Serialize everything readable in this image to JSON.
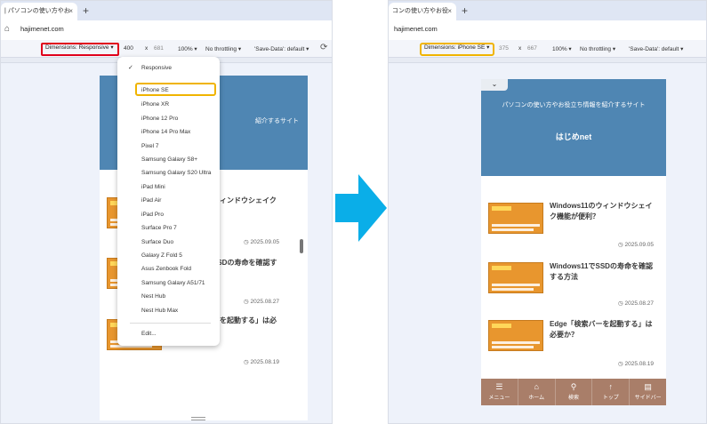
{
  "left": {
    "tab_title": "| パソコンの使い方やお",
    "tab_close": "×",
    "new_tab": "+",
    "address": "hajimenet.com",
    "toolbar": {
      "dimensions_label": "Dimensions: Responsive ▾",
      "width": "400",
      "times": "x",
      "height": "681",
      "zoom": "100% ▾",
      "throttling": "No throttling ▾",
      "save_data": "'Save-Data': default ▾"
    },
    "dropdown": {
      "checkmark": "✓",
      "items": [
        "Responsive",
        "iPhone SE",
        "iPhone XR",
        "iPhone 12 Pro",
        "iPhone 14 Pro Max",
        "Pixel 7",
        "Samsung Galaxy S8+",
        "Samsung Galaxy S20 Ultra",
        "iPad Mini",
        "iPad Air",
        "iPad Pro",
        "Surface Pro 7",
        "Surface Duo",
        "Galaxy Z Fold 5",
        "Asus Zenbook Fold",
        "Samsung Galaxy A51/71",
        "Nest Hub",
        "Nest Hub Max"
      ],
      "edit": "Edit..."
    },
    "page": {
      "hero_tagline": "紹介するサイト",
      "articles": [
        {
          "title_line1": "ウィンドウシェイク",
          "title_line2": "",
          "date": "◷ 2025.09.05"
        },
        {
          "title_line1": "SSDの寿命を確認す",
          "title_line2": "",
          "date": "◷ 2025.08.27"
        },
        {
          "title_line1": "ーを起動する」は必",
          "title_line2": "",
          "date": "◷ 2025.08.19"
        }
      ]
    }
  },
  "right": {
    "tab_title": "コンの使い方やお役",
    "tab_close": "×",
    "new_tab": "+",
    "address": "hajimenet.com",
    "toolbar": {
      "dimensions_label": "Dimensions: iPhone SE ▾",
      "width": "375",
      "times": "x",
      "height": "667",
      "zoom": "100% ▾",
      "throttling": "No throttling ▾",
      "save_data": "'Save-Data': default ▾"
    },
    "page": {
      "chevron": "⌄",
      "hero_tagline": "パソコンの使い方やお役立ち情報を紹介するサイト",
      "brand": "はじめnet",
      "articles": [
        {
          "title_line1": "Windows11のウィンドウシェイ",
          "title_line2": "ク機能が便利？",
          "date": "◷ 2025.09.05"
        },
        {
          "title_line1": "Windows11でSSDの寿命を確認",
          "title_line2": "する方法",
          "date": "◷ 2025.08.27"
        },
        {
          "title_line1": "Edge「検索バーを起動する」は",
          "title_line2": "必要か？",
          "date": "◷ 2025.08.19"
        }
      ],
      "nav": [
        {
          "icon": "☰",
          "label": "メニュー"
        },
        {
          "icon": "⌂",
          "label": "ホーム"
        },
        {
          "icon": "⚲",
          "label": "検索"
        },
        {
          "icon": "↑",
          "label": "トップ"
        },
        {
          "icon": "▤",
          "label": "サイドバー"
        }
      ]
    }
  },
  "colors": {
    "arrow": "#0aaee8",
    "red_highlight": "#e0001b",
    "yellow_highlight": "#f0b400",
    "hero_blue": "#4f86b3",
    "nav_brown": "#a97e69",
    "thumb_orange": "#e8962e"
  }
}
